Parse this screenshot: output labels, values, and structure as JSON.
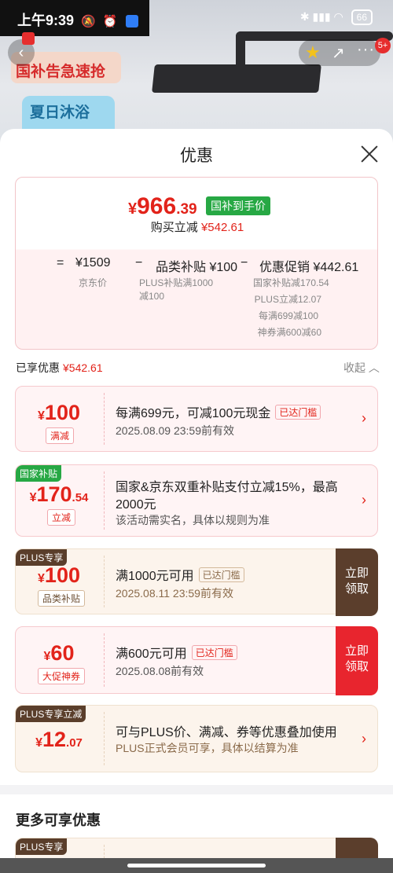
{
  "status_bar": {
    "time": "上午9:39",
    "battery": "66"
  },
  "background": {
    "banner_text": "国补告急速抢",
    "promo_text": "夏日沐浴",
    "notification_badge": "5+"
  },
  "sheet": {
    "title": "优惠",
    "summary": {
      "price_yen": "¥",
      "price_int": "966",
      "price_dec": ".39",
      "price_tag": "国补到手价",
      "reduce_label": "购买立减",
      "reduce_value": "¥542.61",
      "eq": "=",
      "base_price": "¥1509",
      "base_label": "京东价",
      "minus1": "−",
      "category_subsidy": "品类补贴 ¥100",
      "category_note": "PLUS补贴满1000减100",
      "minus2": "−",
      "promo_discount": "优惠促销 ¥442.61",
      "promo_notes": [
        "国家补贴减170.54",
        "PLUS立减12.07",
        "每满699减100",
        "神券满600减60"
      ]
    },
    "enjoyed": {
      "label": "已享优惠",
      "value": "¥542.61",
      "collapse": "收起 ︿"
    },
    "cards": [
      {
        "yen": "¥",
        "int": "100",
        "dec": "",
        "category": "满减",
        "title": "每满699元，可减100元现金",
        "threshold": "已达门槛",
        "meta": "2025.08.09 23:59前有效",
        "chev": "›"
      },
      {
        "corner": "国家补贴",
        "yen": "¥",
        "int": "170",
        "dec": ".54",
        "category": "立减",
        "title": "国家&京东双重补贴支付立减15%，最高",
        "title2": "2000元",
        "meta": "该活动需实名，具体以规则为准",
        "chev": "›"
      },
      {
        "corner": "PLUS专享",
        "yen": "¥",
        "int": "100",
        "dec": "",
        "category": "品类补贴",
        "title": "满1000元可用",
        "threshold": "已达门槛",
        "meta": "2025.08.11 23:59前有效",
        "claim": "立即领取"
      },
      {
        "yen": "¥",
        "int": "60",
        "dec": "",
        "category": "大促神券",
        "title": "满600元可用",
        "threshold": "已达门槛",
        "meta": "2025.08.08前有效",
        "claim": "立即领取"
      },
      {
        "corner": "PLUS专享立减",
        "yen": "¥",
        "int": "12",
        "dec": ".07",
        "title": "可与PLUS价、满减、券等优惠叠加使用",
        "meta": "PLUS正式会员可享，具体以结算为准",
        "chev": "›"
      }
    ],
    "more_title": "更多可享优惠",
    "more_corner": "PLUS专享"
  },
  "colors": {
    "accent_red": "#e2231a",
    "green": "#27a844",
    "plus_brown": "#5b3e2c"
  }
}
